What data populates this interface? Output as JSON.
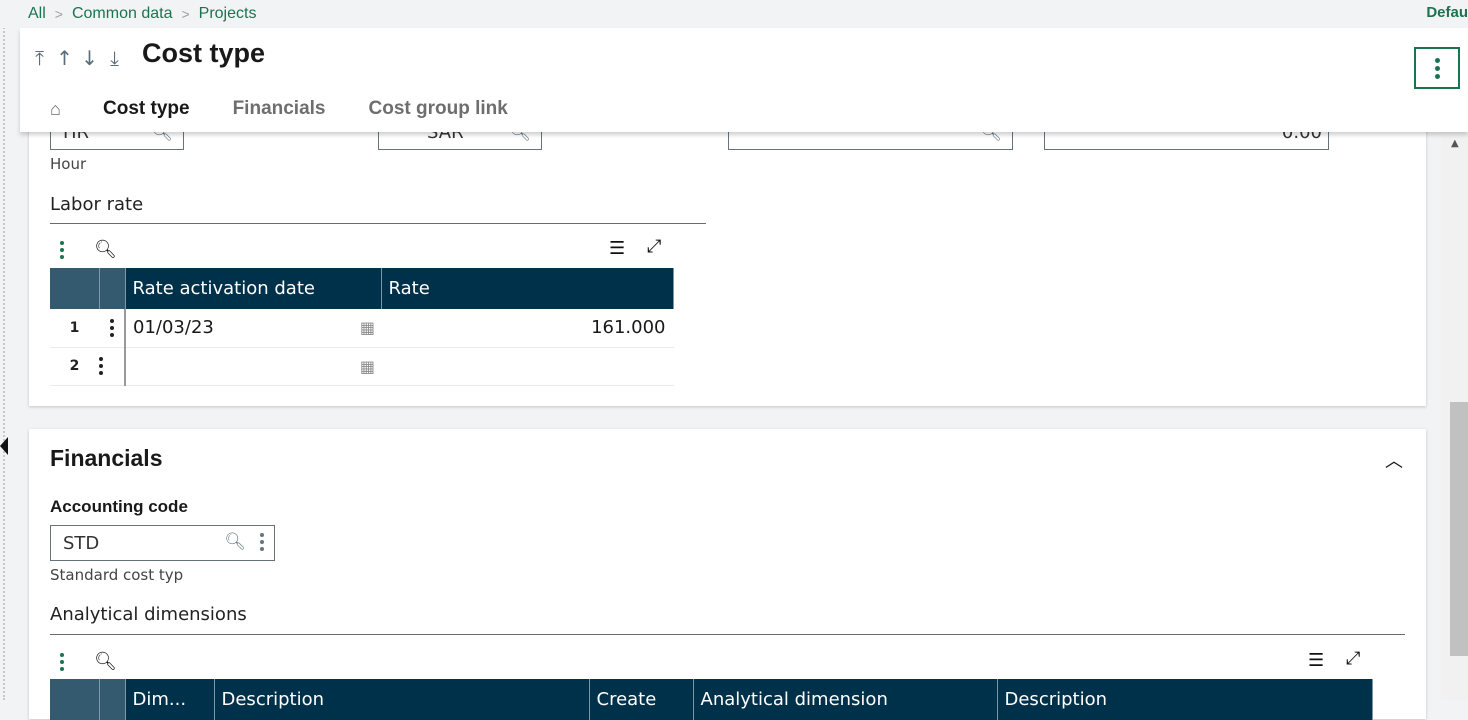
{
  "breadcrumb": {
    "items": [
      "All",
      "Common data",
      "Projects"
    ],
    "right_label": "Defau"
  },
  "header": {
    "title": "Cost type",
    "nav_arrows": [
      "first-record-icon",
      "previous-record-icon",
      "next-record-icon",
      "last-record-icon"
    ],
    "tabs": [
      {
        "label": "Cost type",
        "active": true
      },
      {
        "label": "Financials",
        "active": false
      },
      {
        "label": "Cost group link",
        "active": false
      }
    ]
  },
  "cost_type_section": {
    "unit_field": {
      "value": "HR",
      "description": "Hour"
    },
    "currency_field": {
      "value": "SAR"
    },
    "third_field": {
      "value": ""
    },
    "amount_field": {
      "value": "0.00"
    },
    "labor_rate": {
      "title": "Labor rate",
      "columns": [
        "Rate activation date",
        "Rate"
      ],
      "rows": [
        {
          "num": "1",
          "date": "01/03/23",
          "rate": "161.000"
        },
        {
          "num": "2",
          "date": "",
          "rate": ""
        }
      ]
    }
  },
  "financials_section": {
    "title": "Financials",
    "accounting_code": {
      "label": "Accounting code",
      "value": "STD",
      "description": "Standard cost typ"
    },
    "analytical": {
      "title": "Analytical dimensions",
      "columns": [
        "Dim...",
        "Description",
        "Create",
        "Analytical dimension",
        "Description"
      ]
    }
  }
}
